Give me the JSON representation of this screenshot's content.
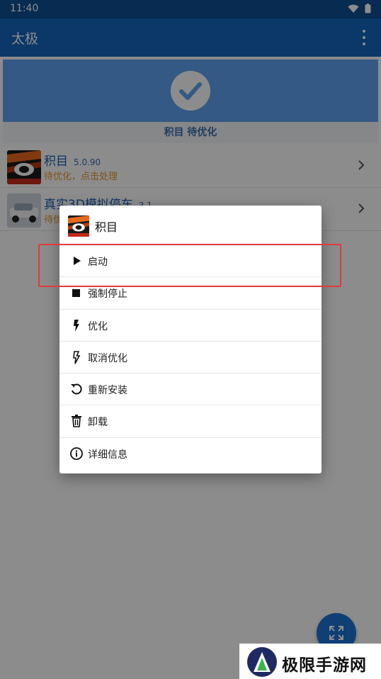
{
  "statusbar": {
    "time": "11:40"
  },
  "appbar": {
    "title": "太极"
  },
  "banner": {
    "caption": "积目 待优化"
  },
  "apps": [
    {
      "name": "积目",
      "version": "5.0.90",
      "status": "待优化，点击处理"
    },
    {
      "name": "真实3D模拟停车",
      "version": "3.1",
      "status": "待优化"
    }
  ],
  "dialog": {
    "title": "积目",
    "items": [
      {
        "label": "启动",
        "icon": "play-icon"
      },
      {
        "label": "强制停止",
        "icon": "stop-icon"
      },
      {
        "label": "优化",
        "icon": "bolt-icon"
      },
      {
        "label": "取消优化",
        "icon": "bolt-off-icon"
      },
      {
        "label": "重新安装",
        "icon": "reinstall-icon"
      },
      {
        "label": "卸载",
        "icon": "trash-icon"
      },
      {
        "label": "详细信息",
        "icon": "info-icon"
      }
    ]
  },
  "watermark": {
    "text": "极限手游网"
  },
  "colors": {
    "appbar": "#1565c0",
    "statusbar": "#0d4f94",
    "banner": "#5fa2f0",
    "pending": "#e69a29",
    "highlight": "#e23a3a"
  }
}
